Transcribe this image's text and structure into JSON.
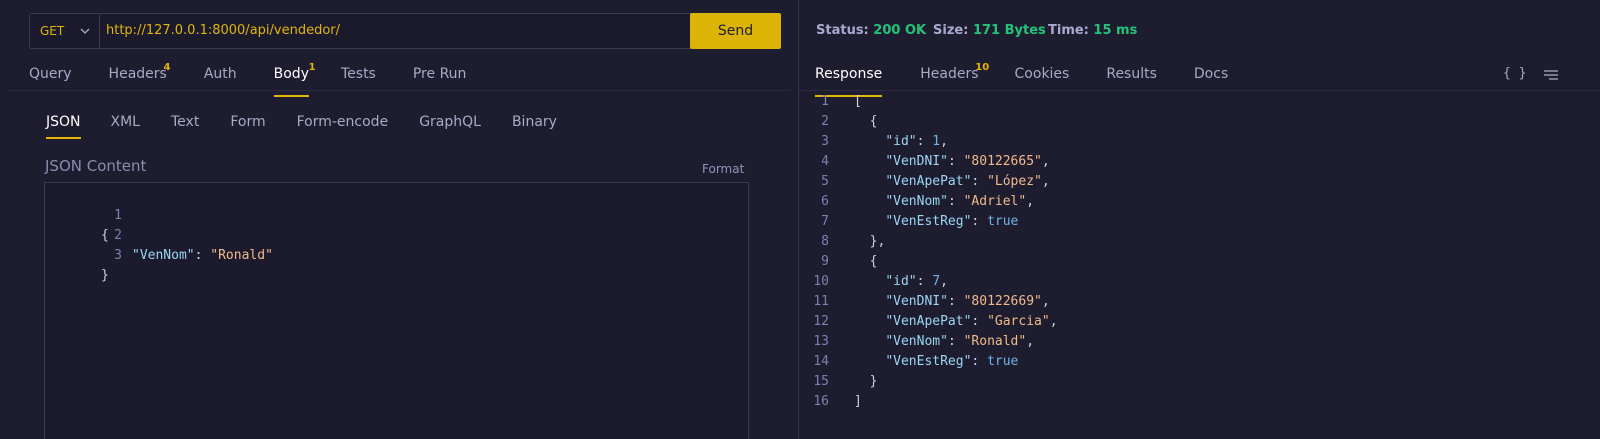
{
  "request": {
    "method": "GET",
    "url": "http://127.0.0.1:8000/api/vendedor/",
    "send_label": "Send",
    "tabs": [
      {
        "label": "Query",
        "badge": ""
      },
      {
        "label": "Headers",
        "badge": "4"
      },
      {
        "label": "Auth",
        "badge": ""
      },
      {
        "label": "Body",
        "badge": "1"
      },
      {
        "label": "Tests",
        "badge": ""
      },
      {
        "label": "Pre Run",
        "badge": ""
      }
    ],
    "active_tab": "Body",
    "body_tabs": [
      "JSON",
      "XML",
      "Text",
      "Form",
      "Form-encode",
      "GraphQL",
      "Binary"
    ],
    "active_body_tab": "JSON",
    "content_label": "JSON Content",
    "format_label": "Format",
    "lines": [
      {
        "num": "1",
        "text": "{"
      },
      {
        "num": "2",
        "key": "\"VenNom\"",
        "sep": ": ",
        "value": "\"Ronald\""
      },
      {
        "num": "3",
        "text": "}"
      }
    ]
  },
  "response": {
    "status_label": "Status:",
    "status_value": "200 OK",
    "size_label": "Size:",
    "size_value": "171 Bytes",
    "time_label": "Time:",
    "time_value": "15 ms",
    "tabs": [
      {
        "label": "Response",
        "badge": ""
      },
      {
        "label": "Headers",
        "badge": "10"
      },
      {
        "label": "Cookies",
        "badge": ""
      },
      {
        "label": "Results",
        "badge": ""
      },
      {
        "label": "Docs",
        "badge": ""
      }
    ],
    "active_tab": "Response",
    "icons": [
      "braces-icon",
      "menu-icon"
    ],
    "braces_glyph": "{ }",
    "lines": [
      {
        "num": "1",
        "indent": "",
        "text": "["
      },
      {
        "num": "2",
        "indent": "  ",
        "text": "{"
      },
      {
        "num": "3",
        "indent": "    ",
        "key": "\"id\"",
        "value": "1",
        "vtype": "n",
        "comma": ","
      },
      {
        "num": "4",
        "indent": "    ",
        "key": "\"VenDNI\"",
        "value": "\"80122665\"",
        "vtype": "s",
        "comma": ","
      },
      {
        "num": "5",
        "indent": "    ",
        "key": "\"VenApePat\"",
        "value": "\"López\"",
        "vtype": "s",
        "comma": ","
      },
      {
        "num": "6",
        "indent": "    ",
        "key": "\"VenNom\"",
        "value": "\"Adriel\"",
        "vtype": "s",
        "comma": ","
      },
      {
        "num": "7",
        "indent": "    ",
        "key": "\"VenEstReg\"",
        "value": "true",
        "vtype": "b",
        "comma": ""
      },
      {
        "num": "8",
        "indent": "  ",
        "text": "},"
      },
      {
        "num": "9",
        "indent": "  ",
        "text": "{"
      },
      {
        "num": "10",
        "indent": "    ",
        "key": "\"id\"",
        "value": "7",
        "vtype": "n",
        "comma": ","
      },
      {
        "num": "11",
        "indent": "    ",
        "key": "\"VenDNI\"",
        "value": "\"80122669\"",
        "vtype": "s",
        "comma": ","
      },
      {
        "num": "12",
        "indent": "    ",
        "key": "\"VenApePat\"",
        "value": "\"Garcia\"",
        "vtype": "s",
        "comma": ","
      },
      {
        "num": "13",
        "indent": "    ",
        "key": "\"VenNom\"",
        "value": "\"Ronald\"",
        "vtype": "s",
        "comma": ","
      },
      {
        "num": "14",
        "indent": "    ",
        "key": "\"VenEstReg\"",
        "value": "true",
        "vtype": "b",
        "comma": ""
      },
      {
        "num": "15",
        "indent": "  ",
        "text": "}"
      },
      {
        "num": "16",
        "indent": "",
        "text": "]"
      }
    ]
  },
  "colors": {
    "accent": "#e3b505",
    "status_ok": "#23c47a",
    "background": "#1e1d30"
  }
}
